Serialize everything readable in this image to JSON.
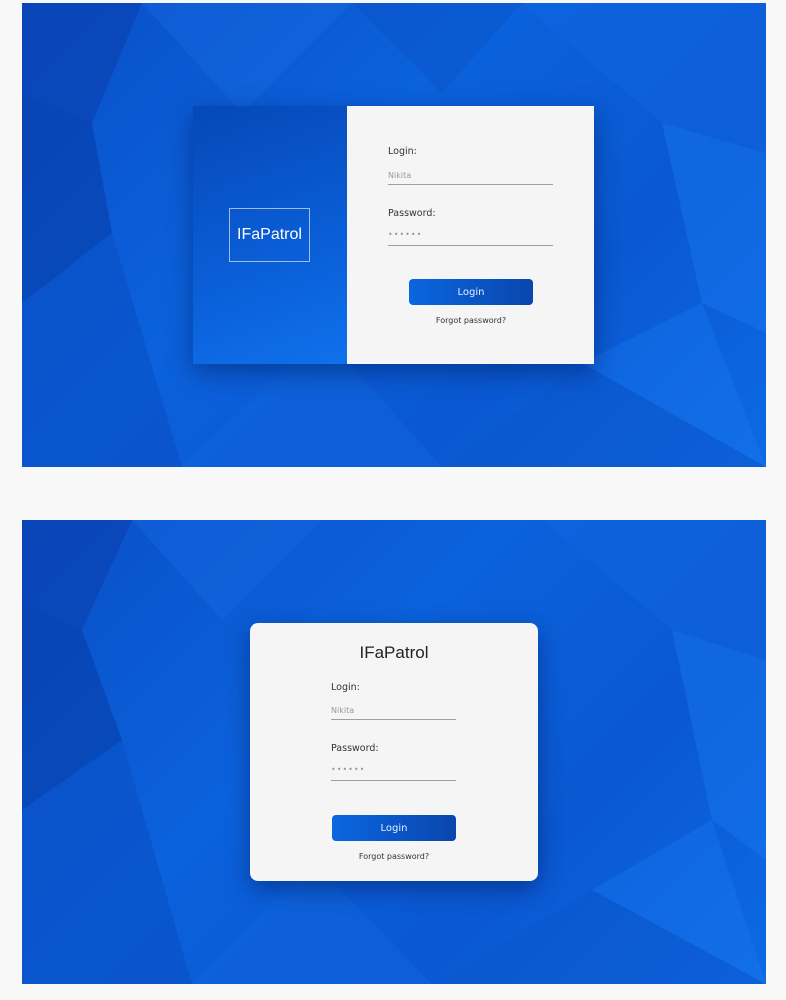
{
  "variant_split": {
    "logo": "IFaPatrol",
    "login_label": "Login:",
    "login_value": "Nikita",
    "password_label": "Password:",
    "password_value": "••••••",
    "login_button": "Login",
    "forgot_link": "Forgot password?"
  },
  "variant_centered": {
    "logo": "IFaPatrol",
    "login_label": "Login:",
    "login_value": "Nikita",
    "password_label": "Password:",
    "password_value": "••••••",
    "login_button": "Login",
    "forgot_link": "Forgot password?"
  }
}
